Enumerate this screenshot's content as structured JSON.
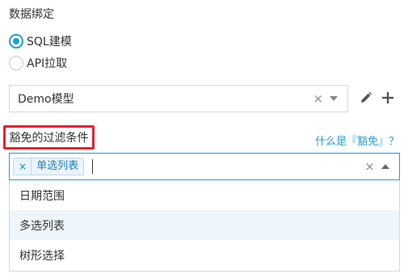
{
  "section": {
    "title": "数据绑定"
  },
  "binding": {
    "options": [
      {
        "label": "SQL建模",
        "checked": true
      },
      {
        "label": "API拉取",
        "checked": false
      }
    ]
  },
  "model_select": {
    "value": "Demo模型",
    "clear_icon": "close-icon",
    "arrow_icon": "caret-down-icon"
  },
  "actions": {
    "edit_icon": "pencil-icon",
    "add_icon": "plus-icon"
  },
  "filter": {
    "label": "豁免的过滤条件",
    "help_link": "什么是『豁免』？",
    "selected_tag": "单选列表",
    "tag_remove": "×",
    "clear": "×",
    "options": [
      "日期范围",
      "多选列表",
      "树形选择"
    ],
    "highlighted_index": 1
  },
  "colors": {
    "accent": "#1e9fd6",
    "highlight_border": "#e8212a",
    "option_hover": "#eef5fb"
  }
}
